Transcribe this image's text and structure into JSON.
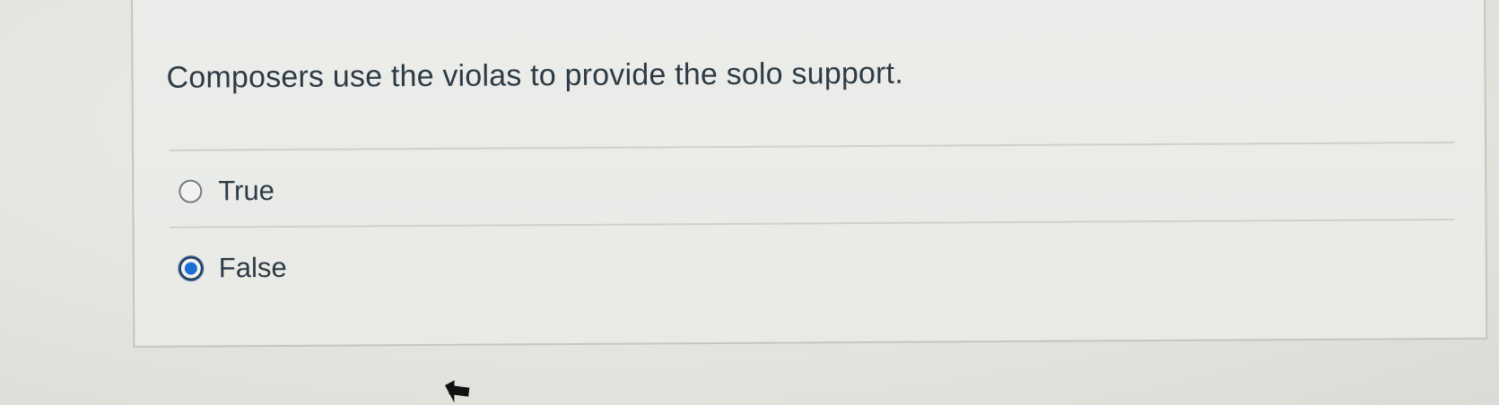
{
  "question": {
    "text": "Composers use the violas to provide the solo support."
  },
  "answers": [
    {
      "label": "True",
      "selected": false
    },
    {
      "label": "False",
      "selected": true
    }
  ],
  "colors": {
    "text": "#2d3b45",
    "radio_selected": "#1d6fd6",
    "card_background": "#ecedea"
  },
  "icons": {
    "pointer": "mouse-pointer-icon"
  }
}
